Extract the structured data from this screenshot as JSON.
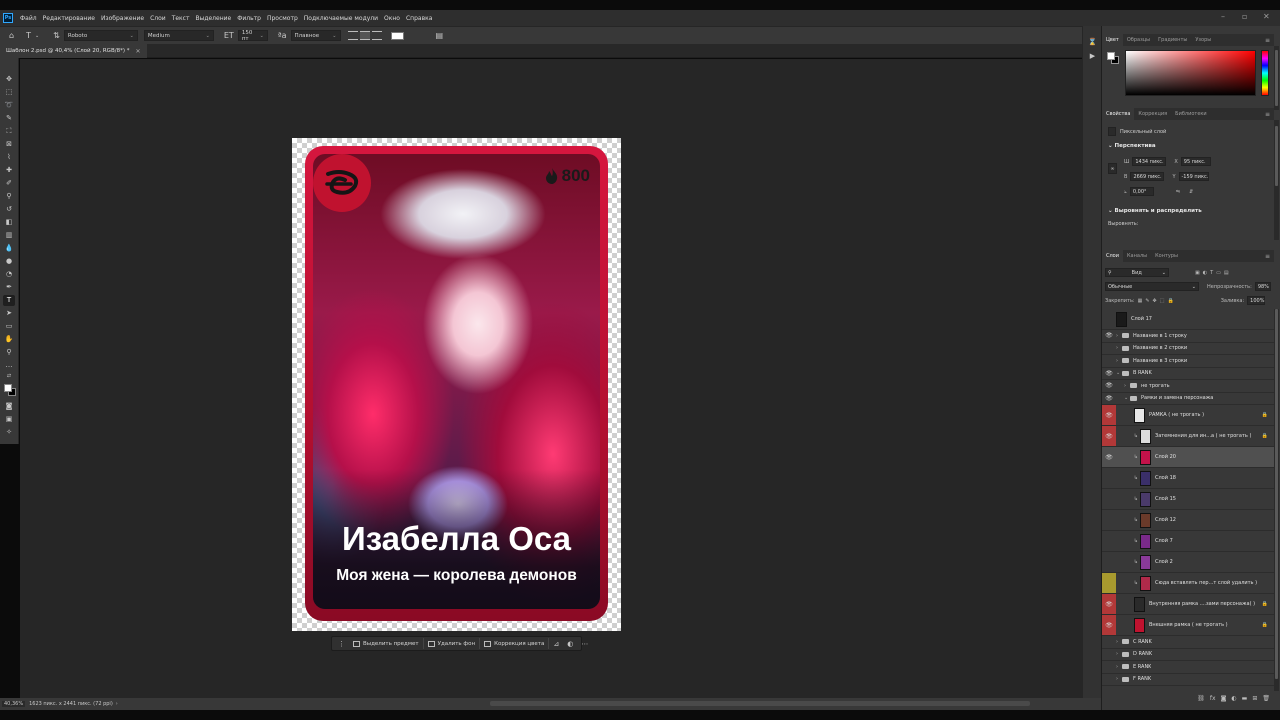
{
  "menubar": {
    "items": [
      "Файл",
      "Редактирование",
      "Изображение",
      "Слои",
      "Текст",
      "Выделение",
      "Фильтр",
      "Просмотр",
      "Подключаемые модули",
      "Окно",
      "Справка"
    ]
  },
  "options": {
    "font_family": "Roboto",
    "font_style": "Medium",
    "font_size": "150 пт",
    "aa_mode": "Плавное",
    "text_color": "#ffffff"
  },
  "document": {
    "tab_title": "Шаблон 2.psd @ 40,4% (Слой 20, RGB/8*) *"
  },
  "card": {
    "price": "800",
    "name": "Изабелла Оса",
    "subtitle": "Моя жена — королева демонов",
    "frame_color": "#d6163e"
  },
  "taskbar": {
    "select_subject": "Выделить предмет",
    "remove_bg": "Удалить фон",
    "color_correction": "Коррекция цвета"
  },
  "status": {
    "zoom": "40,36%",
    "doc_info": "1623 пикс. x 2441 пикс. (72 ppi)"
  },
  "color_panel": {
    "tabs": [
      "Цвет",
      "Образцы",
      "Градиенты",
      "Узоры"
    ]
  },
  "properties": {
    "tabs": [
      "Свойства",
      "Коррекция",
      "Библиотеки"
    ],
    "layer_type": "Пиксельный слой",
    "section_transform": "Перспектива",
    "w_label": "Ш",
    "w_value": "1434 пикс.",
    "h_label": "В",
    "h_value": "2669 пикс.",
    "x_label": "X",
    "x_value": "95 пикс.",
    "y_label": "Y",
    "y_value": "-159 пикс.",
    "angle_value": "0,00°",
    "section_align": "Выровнять и распределить",
    "align_label": "Выровнять:"
  },
  "layers": {
    "tabs": [
      "Слои",
      "Каналы",
      "Контуры"
    ],
    "filter_kind": "Вид",
    "blend_mode": "Обычные",
    "opacity_label": "Непрозрачность:",
    "opacity_value": "98%",
    "lock_label": "Закрепить:",
    "fill_label": "Заливка:",
    "fill_value": "100%",
    "rows": [
      {
        "name": "Слой 17"
      },
      {
        "name": "Название в 1 строку"
      },
      {
        "name": "Название в 2 строки"
      },
      {
        "name": "Название в 3 строки"
      },
      {
        "name": "B RANK"
      },
      {
        "name": "не трогать"
      },
      {
        "name": "Рамки и замена персонажа"
      },
      {
        "name": "РАМКА ( не трогать )"
      },
      {
        "name": "Затемнения для ин...а ( не трогать )"
      },
      {
        "name": "Слой 20"
      },
      {
        "name": "Слой 18"
      },
      {
        "name": "Слой 15"
      },
      {
        "name": "Слой 12"
      },
      {
        "name": "Слой 7"
      },
      {
        "name": "Слой 2"
      },
      {
        "name": "Сюда вставлять пер...т слой удалить )"
      },
      {
        "name": "Внутренняя рамка ....зами персонажа( )"
      },
      {
        "name": "Внешняя рамка ( не трогать )"
      },
      {
        "name": "C RANK"
      },
      {
        "name": "D RANK"
      },
      {
        "name": "E RANK"
      },
      {
        "name": "F RANK"
      }
    ]
  }
}
